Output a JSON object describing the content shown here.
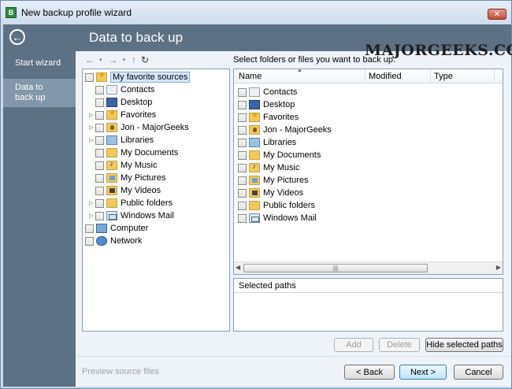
{
  "window": {
    "title": "New backup profile wizard",
    "close_label": "✕"
  },
  "watermark": "MAJORGEEKS.COM",
  "sidebar": {
    "back_icon": "←",
    "items": [
      {
        "label": "Start wizard",
        "selected": false
      },
      {
        "label": "Data to\nback up",
        "selected": true
      }
    ]
  },
  "header": {
    "title": "Data to back up"
  },
  "toolbar": {
    "back": "←",
    "back_drop": "▾",
    "forward": "→",
    "forward_drop": "▾",
    "up": "↑",
    "refresh": "↻"
  },
  "hint": "Select folders or files you want to back up.",
  "tree": {
    "root": {
      "label": "My favorite sources",
      "icon": "star-icon"
    },
    "children": [
      {
        "label": "Contacts",
        "icon": "contacts-icon",
        "expandable": false
      },
      {
        "label": "Desktop",
        "icon": "desktop-icon",
        "expandable": false
      },
      {
        "label": "Favorites",
        "icon": "favorites-icon",
        "expandable": true
      },
      {
        "label": "Jon - MajorGeeks",
        "icon": "user-folder-icon",
        "expandable": true
      },
      {
        "label": "Libraries",
        "icon": "libraries-icon",
        "expandable": true
      },
      {
        "label": "My Documents",
        "icon": "documents-folder-icon",
        "expandable": false
      },
      {
        "label": "My Music",
        "icon": "music-folder-icon",
        "expandable": false
      },
      {
        "label": "My Pictures",
        "icon": "pictures-folder-icon",
        "expandable": false
      },
      {
        "label": "My Videos",
        "icon": "videos-folder-icon",
        "expandable": false
      },
      {
        "label": "Public folders",
        "icon": "folder-icon",
        "expandable": true
      },
      {
        "label": "Windows Mail",
        "icon": "mail-icon",
        "expandable": true
      }
    ],
    "top_level": [
      {
        "label": "Computer",
        "icon": "computer-icon"
      },
      {
        "label": "Network",
        "icon": "network-icon"
      }
    ]
  },
  "list": {
    "columns": [
      "Name",
      "Modified",
      "Type"
    ],
    "sort_indicator": "▲",
    "rows": [
      "Contacts",
      "Desktop",
      "Favorites",
      "Jon - MajorGeeks",
      "Libraries",
      "My Documents",
      "My Music",
      "My Pictures",
      "My Videos",
      "Public folders",
      "Windows Mail"
    ],
    "scroll_left": "◀",
    "scroll_right": "▶",
    "scroll_grip": "|||"
  },
  "paths": {
    "header": "Selected paths"
  },
  "buttons": {
    "add": "Add",
    "delete": "Delete",
    "hide_paths": "Hide selected paths",
    "back": "< Back",
    "next": "Next >",
    "cancel": "Cancel"
  },
  "footer": {
    "preview": "Preview source files"
  }
}
